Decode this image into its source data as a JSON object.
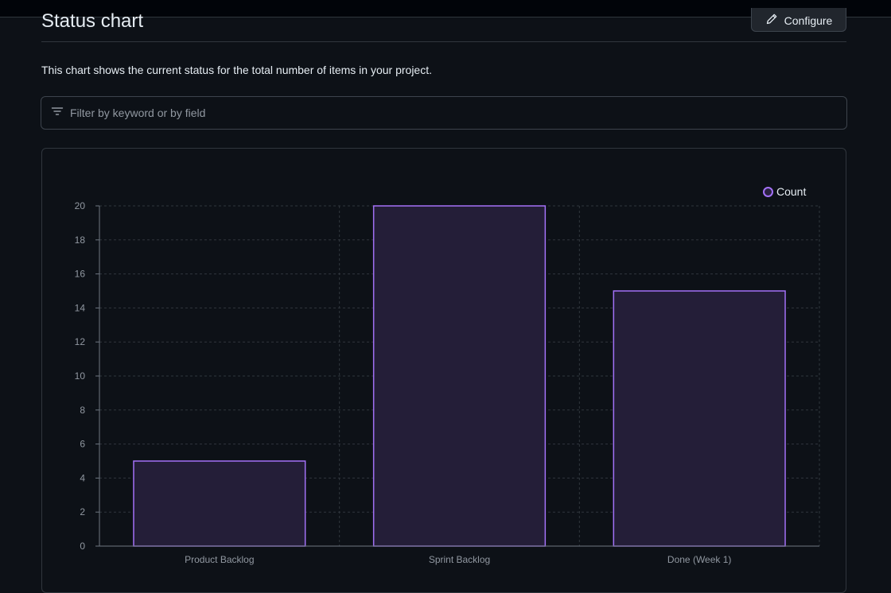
{
  "page": {
    "title": "Status chart",
    "configure_label": "Configure",
    "description": "This chart shows the current status for the total number of items in your project.",
    "filter_placeholder": "Filter by keyword or by field"
  },
  "icons": {
    "configure": "pencil-icon",
    "filter": "filter-icon",
    "legend": "circle-icon"
  },
  "colors": {
    "bar_stroke": "#a371f7",
    "bar_fill": "#241e38",
    "grid": "#30363d",
    "axis_text": "#9198a1"
  },
  "chart_data": {
    "type": "bar",
    "categories": [
      "Product Backlog",
      "Sprint Backlog",
      "Done (Week 1)"
    ],
    "series": [
      {
        "name": "Count",
        "values": [
          5,
          20,
          15
        ]
      }
    ],
    "ylim": [
      0,
      20
    ],
    "yticks": [
      0,
      2,
      4,
      6,
      8,
      10,
      12,
      14,
      16,
      18,
      20
    ],
    "grid": true,
    "legend_position": "top-right"
  }
}
